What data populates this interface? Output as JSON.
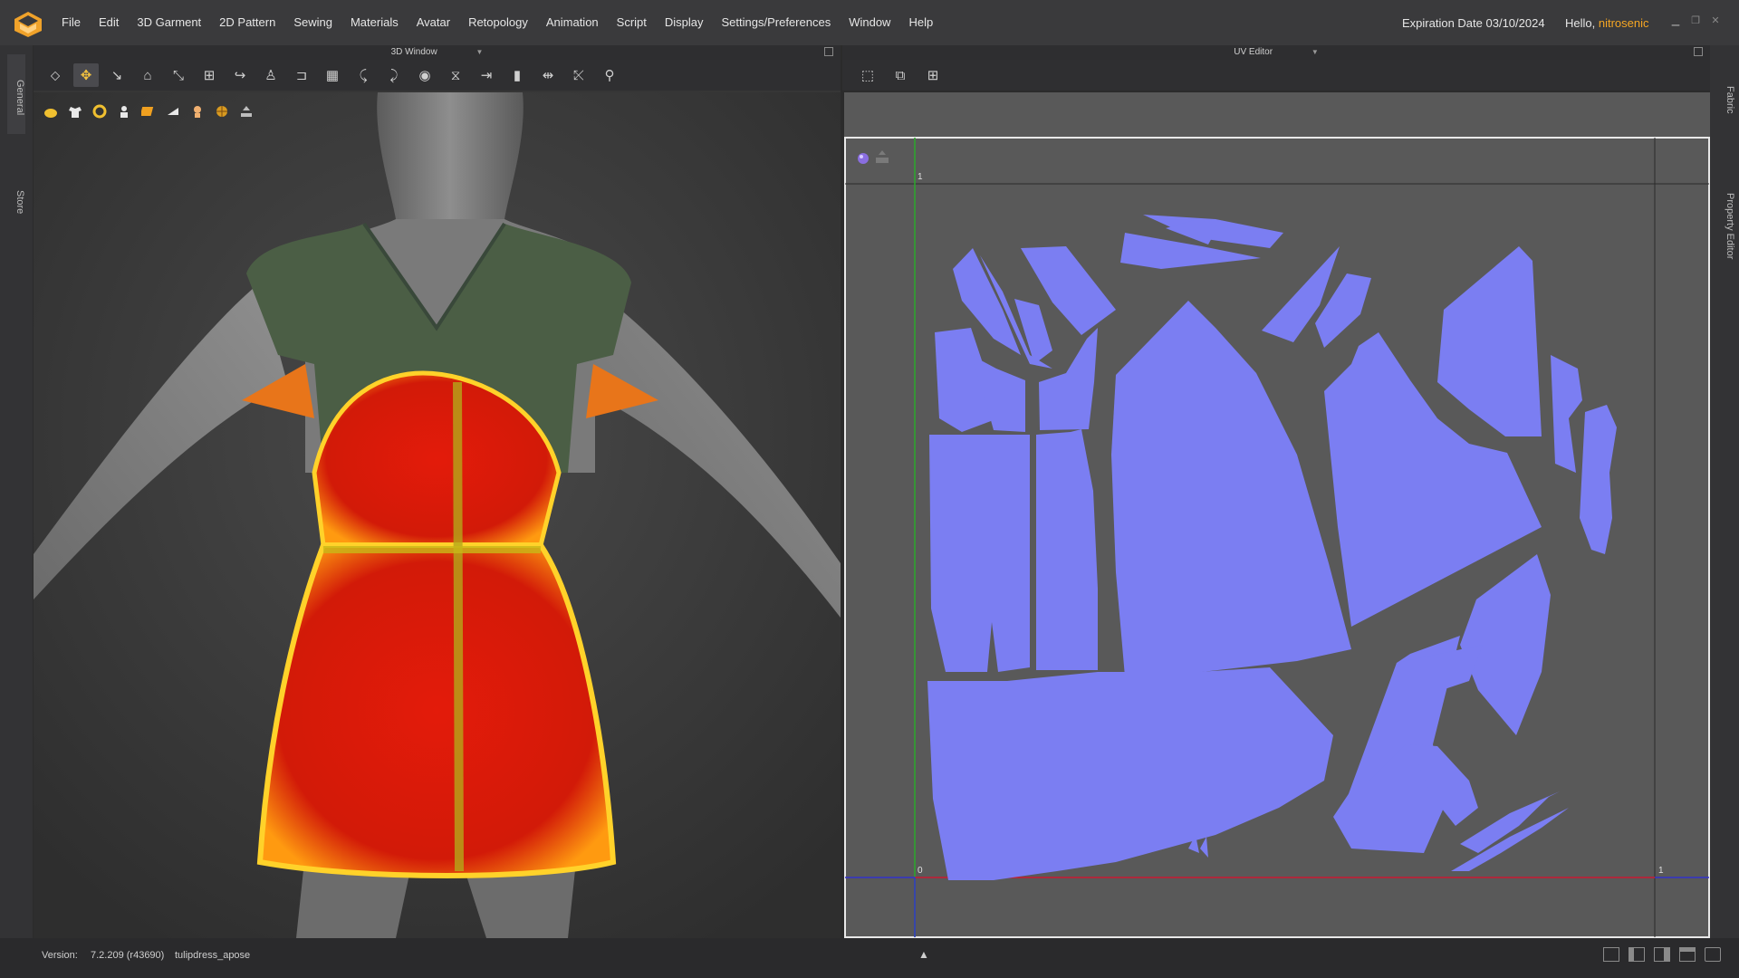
{
  "app": {
    "logo_icon": "clo-logo-icon",
    "menu": [
      "File",
      "Edit",
      "3D Garment",
      "2D Pattern",
      "Sewing",
      "Materials",
      "Avatar",
      "Retopology",
      "Animation",
      "Script",
      "Display",
      "Settings/Preferences",
      "Window",
      "Help"
    ],
    "expiration": "Expiration Date 03/10/2024",
    "hello_prefix": "Hello,",
    "user": "nitrosenic",
    "window_controls": [
      "minimize-icon",
      "restore-icon",
      "close-icon"
    ]
  },
  "left_tabs": [
    "General",
    "Store"
  ],
  "right_tabs": [
    "Fabric",
    "Property Editor"
  ],
  "window_3d": {
    "title": "3D Window",
    "toolbar_icons": [
      "select-icon",
      "move-icon",
      "edit-mesh-icon",
      "fold-icon",
      "sew-icon",
      "arrange-icon",
      "pin-icon",
      "avatar-icon",
      "measure-icon",
      "texture-icon",
      "button-icon",
      "topstitch-icon",
      "fit-icon",
      "seam-icon",
      "align-icon",
      "flatten-icon",
      "tuck-icon",
      "point-icon",
      "pose-icon"
    ],
    "display_icons": [
      "avatar-display-icon",
      "garment-display-icon",
      "fabric-icon",
      "avatar-pose-icon",
      "strain-map-icon",
      "texture-icon",
      "skin-icon",
      "globe-icon",
      "export-icon"
    ]
  },
  "uv_editor": {
    "title": "UV Editor",
    "toolbar_icons": [
      "uv-select-icon",
      "uv-transform-icon",
      "uv-arrange-icon"
    ],
    "canvas_icons": [
      "sphere-icon",
      "export-icon"
    ],
    "axis_labels": {
      "top": "1",
      "origin": "0",
      "right": "1"
    },
    "piece_color": "#7b7ef2"
  },
  "status": {
    "version_label": "Version:",
    "version": "7.2.209 (r43690)",
    "file": "tulipdress_apose",
    "layout_icons": [
      "single-layout-icon",
      "split-layout-icon",
      "triple-layout-icon",
      "quad-layout-icon",
      "capture-icon"
    ]
  },
  "colors": {
    "accent": "#f5a623",
    "strain_red": "#e31b0a",
    "garment_green": "#4b5e45"
  }
}
